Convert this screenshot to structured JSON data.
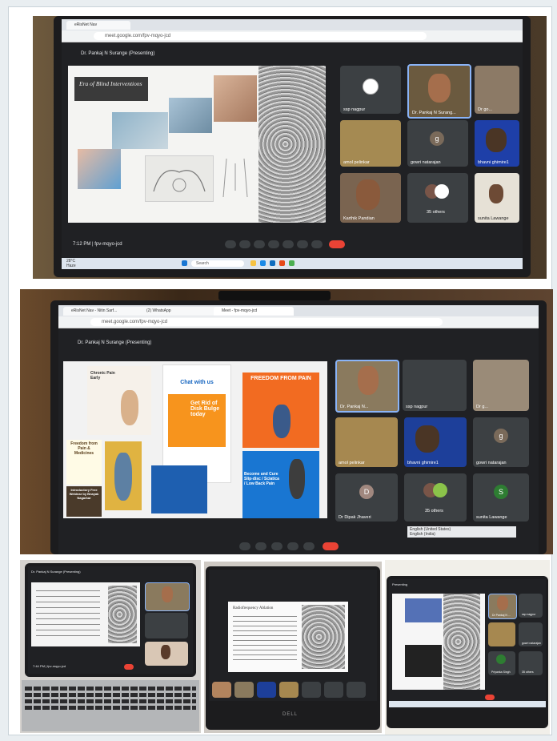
{
  "photo1": {
    "tab_title": "eRisNet Nav",
    "url": "meet.google.com/fpv-mqyo-jcd",
    "presenting": "Dr. Pankaj N Surange (Presenting)",
    "slide_title": "Era of Blind Interventions",
    "time": "7:12 PM",
    "meeting_code": "fpv-mqyo-jcd",
    "weather": "28°C",
    "weather_sub": "Haze",
    "search": "Search",
    "participants": [
      {
        "name": "ssp nagpur"
      },
      {
        "name": "Dr. Pankaj N Surang..."
      },
      {
        "name": "Dr go..."
      },
      {
        "name": "amol pelinkar"
      },
      {
        "name": "gowri natarajan",
        "initial": "g"
      },
      {
        "name": "bhavni ghimire1"
      },
      {
        "name": "Karthik Pandian"
      },
      {
        "name": "35 others"
      },
      {
        "name": "sunita Lawange"
      }
    ]
  },
  "photo2": {
    "tabs": [
      "eRisNet Nav - Nitin Sarf...",
      "(2) WhatsApp",
      "Meet - fpv-mqyo-jcd"
    ],
    "url": "meet.google.com/fpv-mqyo-jcd",
    "presenting": "Dr. Pankaj N Surange (Presenting)",
    "poster_chronic": "Chronic Pain Early",
    "poster_freedom": "Freedom from Pain & Medicines",
    "poster_intro": "Introductory Free Webinar by Bnayak Nagarkar",
    "poster_chat": "Chat with us",
    "poster_disk": "Get Rid of Disk Bulge today",
    "poster_fp": "FREEDOM FROM PAIN",
    "poster_bc": "Become and Cure Slip-disc / Sciatica / Low Back Pain",
    "participants": [
      {
        "name": "Dr. Pankaj N..."
      },
      {
        "name": "ssp nagpur"
      },
      {
        "name": "Dr g..."
      },
      {
        "name": "amol pelinkar"
      },
      {
        "name": "bhavni ghimire1"
      },
      {
        "name": "gowri natarajan",
        "initial": "g"
      },
      {
        "name": "Dr Dipak Jhaveri",
        "initial": "D"
      },
      {
        "name": "35 others"
      },
      {
        "name": "sunita Lawange",
        "initial": "S"
      }
    ],
    "caption_lang": "English (United States)",
    "caption_lang2": "English (India)"
  },
  "photo3": {
    "presenting": "Dr. Pankaj N Surange (Presenting)",
    "meeting_code": "7:44 PM | fpv-mqyo-jcd"
  },
  "photo4": {
    "slide_title": "Radiofrequency Ablation",
    "brand": "DELL"
  },
  "photo5": {
    "presenting": "Presenting",
    "names": [
      "Dr Pankaj N ...",
      "ssp nagpur",
      "gowri natarajan",
      "Priyanka Singh",
      "35 others"
    ]
  },
  "colors": {
    "meet_bg": "#202124",
    "tile_bg": "#3c4043",
    "end_call": "#ea4335",
    "active_speaker": "#8ab4f8",
    "gowri_avatar": "#7a6a5a",
    "dipak_avatar": "#a1887f",
    "sunita_avatar": "#2e7d32"
  }
}
